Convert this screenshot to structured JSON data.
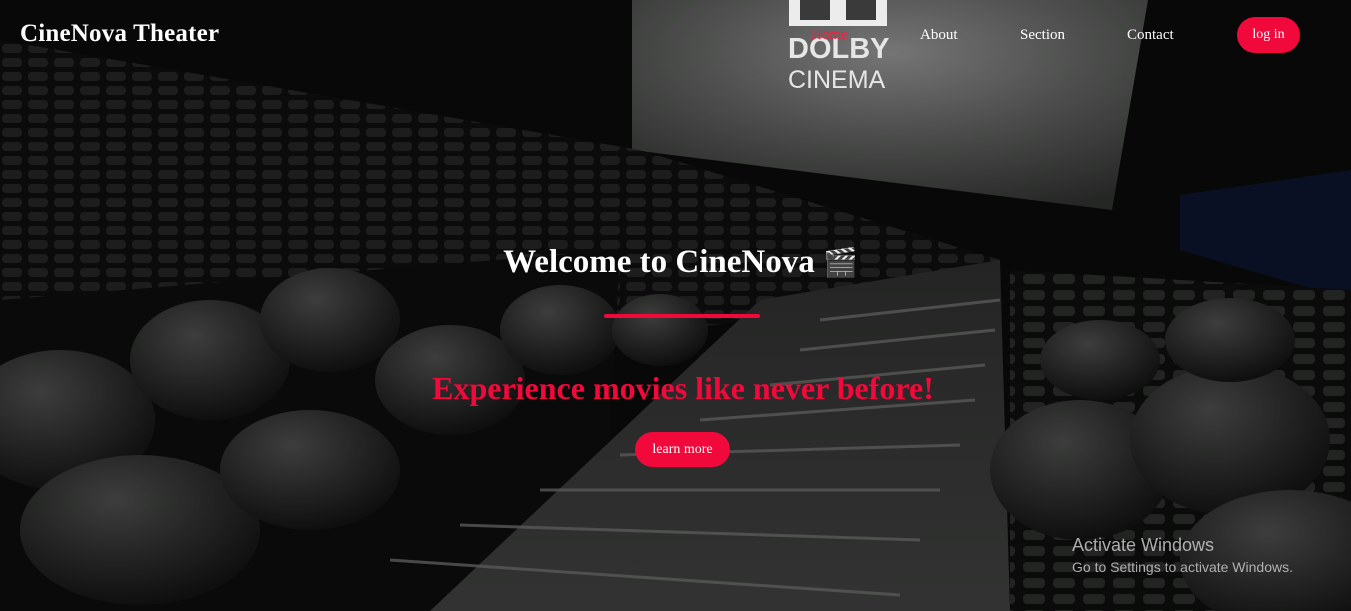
{
  "brand": {
    "name": "CineNova Theater"
  },
  "nav": {
    "items": [
      {
        "label": "Home",
        "active": true
      },
      {
        "label": "About",
        "active": false
      },
      {
        "label": "Section",
        "active": false
      },
      {
        "label": "Contact",
        "active": false
      }
    ],
    "login_label": "log in"
  },
  "hero": {
    "title": "Welcome to CineNova",
    "title_icon": "🎬",
    "subtitle": "Experience movies like never before!",
    "cta_label": "learn more"
  },
  "screen": {
    "logo_line1": "DOLBY",
    "logo_line2": "CINEMA"
  },
  "watermark": {
    "line1": "Activate Windows",
    "line2": "Go to Settings to activate Windows."
  },
  "colors": {
    "accent": "#f0093a",
    "text": "#ffffff",
    "background": "#0b0b0b"
  }
}
